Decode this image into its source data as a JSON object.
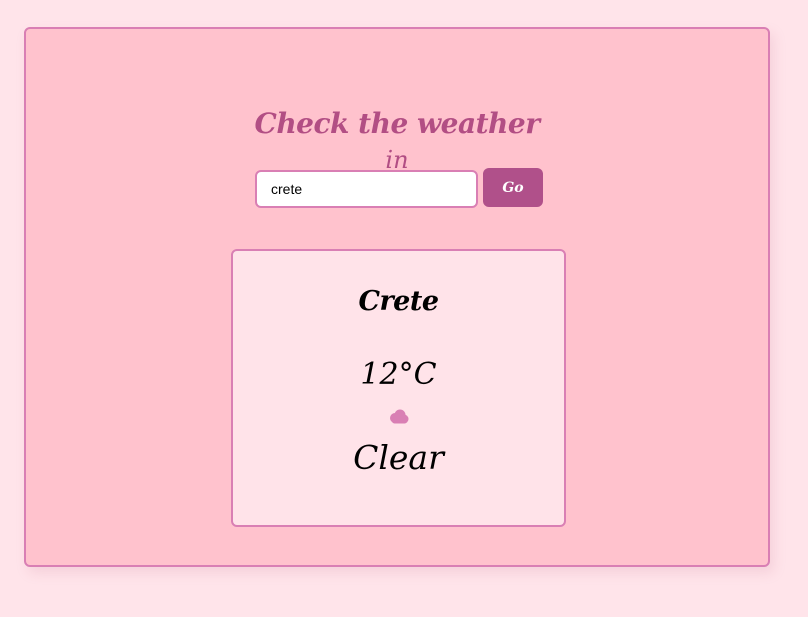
{
  "header": {
    "title": "Check the weather",
    "subtitle": "in"
  },
  "search": {
    "value": "crete",
    "button_label": "Go"
  },
  "weather": {
    "city": "Crete",
    "temperature": "12°C",
    "condition": "Clear",
    "icon": "cloud-icon"
  },
  "colors": {
    "page_background": "#ffe4ea",
    "panel_background": "#ffc2cd",
    "accent": "#b0508a",
    "border": "#d97fb4",
    "card_background": "#ffe3e9"
  }
}
